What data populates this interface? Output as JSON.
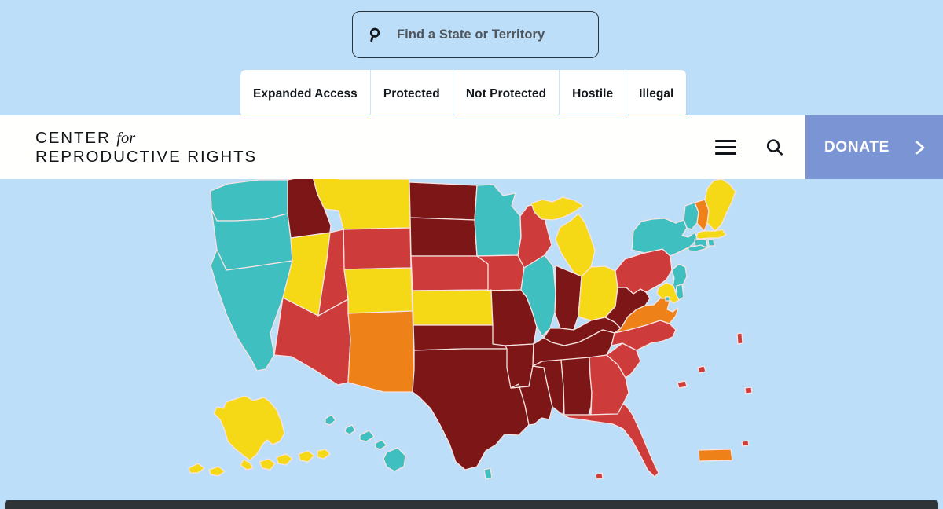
{
  "page": {
    "background_color": "#bcdef8",
    "bottom_bar_color": "#2f3438"
  },
  "search": {
    "icon": "search-icon",
    "placeholder": "Find a State or Territory",
    "value": ""
  },
  "legend": {
    "items": [
      {
        "label": "Expanded Access",
        "color": "#3fbfc0"
      },
      {
        "label": "Protected",
        "color": "#f5d916"
      },
      {
        "label": "Not Protected",
        "color": "#ef8119"
      },
      {
        "label": "Hostile",
        "color": "#cd3b3a"
      },
      {
        "label": "Illegal",
        "color": "#7d1717"
      }
    ]
  },
  "header": {
    "logo_line1": "CENTER",
    "logo_for": "for",
    "logo_line2": "REPRODUCTIVE RIGHTS",
    "menu_icon": "hamburger-menu-icon",
    "search_icon": "search-icon",
    "donate_label": "DONATE",
    "donate_chevron": "chevron-right-icon",
    "donate_color": "#7b94d4"
  },
  "map": {
    "type": "choropleth",
    "region": "United States and territories",
    "ocean_color": "#bcdef8",
    "border_color": "#f7e3e2",
    "categories": {
      "expanded_access": "#3fbfc0",
      "protected": "#f5d916",
      "not_protected": "#ef8119",
      "hostile": "#cd3b3a",
      "illegal": "#7d1717"
    },
    "states": [
      {
        "code": "WA",
        "name": "Washington",
        "status": "Expanded Access",
        "color": "#3fbfc0"
      },
      {
        "code": "OR",
        "name": "Oregon",
        "status": "Expanded Access",
        "color": "#3fbfc0"
      },
      {
        "code": "CA",
        "name": "California",
        "status": "Expanded Access",
        "color": "#3fbfc0"
      },
      {
        "code": "NV",
        "name": "Nevada",
        "status": "Protected",
        "color": "#f5d916"
      },
      {
        "code": "ID",
        "name": "Idaho",
        "status": "Illegal",
        "color": "#7d1717"
      },
      {
        "code": "MT",
        "name": "Montana",
        "status": "Protected",
        "color": "#f5d916"
      },
      {
        "code": "WY",
        "name": "Wyoming",
        "status": "Hostile",
        "color": "#cd3b3a"
      },
      {
        "code": "UT",
        "name": "Utah",
        "status": "Hostile",
        "color": "#cd3b3a"
      },
      {
        "code": "AZ",
        "name": "Arizona",
        "status": "Hostile",
        "color": "#cd3b3a"
      },
      {
        "code": "CO",
        "name": "Colorado",
        "status": "Protected",
        "color": "#f5d916"
      },
      {
        "code": "NM",
        "name": "New Mexico",
        "status": "Not Protected",
        "color": "#ef8119"
      },
      {
        "code": "ND",
        "name": "North Dakota",
        "status": "Illegal",
        "color": "#7d1717"
      },
      {
        "code": "SD",
        "name": "South Dakota",
        "status": "Illegal",
        "color": "#7d1717"
      },
      {
        "code": "NE",
        "name": "Nebraska",
        "status": "Hostile",
        "color": "#cd3b3a"
      },
      {
        "code": "KS",
        "name": "Kansas",
        "status": "Protected",
        "color": "#f5d916"
      },
      {
        "code": "OK",
        "name": "Oklahoma",
        "status": "Illegal",
        "color": "#7d1717"
      },
      {
        "code": "TX",
        "name": "Texas",
        "status": "Illegal",
        "color": "#7d1717"
      },
      {
        "code": "MN",
        "name": "Minnesota",
        "status": "Expanded Access",
        "color": "#3fbfc0"
      },
      {
        "code": "IA",
        "name": "Iowa",
        "status": "Hostile",
        "color": "#cd3b3a"
      },
      {
        "code": "MO",
        "name": "Missouri",
        "status": "Illegal",
        "color": "#7d1717"
      },
      {
        "code": "AR",
        "name": "Arkansas",
        "status": "Illegal",
        "color": "#7d1717"
      },
      {
        "code": "LA",
        "name": "Louisiana",
        "status": "Illegal",
        "color": "#7d1717"
      },
      {
        "code": "WI",
        "name": "Wisconsin",
        "status": "Hostile",
        "color": "#cd3b3a"
      },
      {
        "code": "IL",
        "name": "Illinois",
        "status": "Expanded Access",
        "color": "#3fbfc0"
      },
      {
        "code": "MI",
        "name": "Michigan",
        "status": "Protected",
        "color": "#f5d916"
      },
      {
        "code": "IN",
        "name": "Indiana",
        "status": "Illegal",
        "color": "#7d1717"
      },
      {
        "code": "OH",
        "name": "Ohio",
        "status": "Protected",
        "color": "#f5d916"
      },
      {
        "code": "KY",
        "name": "Kentucky",
        "status": "Illegal",
        "color": "#7d1717"
      },
      {
        "code": "TN",
        "name": "Tennessee",
        "status": "Illegal",
        "color": "#7d1717"
      },
      {
        "code": "MS",
        "name": "Mississippi",
        "status": "Illegal",
        "color": "#7d1717"
      },
      {
        "code": "AL",
        "name": "Alabama",
        "status": "Illegal",
        "color": "#7d1717"
      },
      {
        "code": "GA",
        "name": "Georgia",
        "status": "Hostile",
        "color": "#cd3b3a"
      },
      {
        "code": "FL",
        "name": "Florida",
        "status": "Hostile",
        "color": "#cd3b3a"
      },
      {
        "code": "SC",
        "name": "South Carolina",
        "status": "Hostile",
        "color": "#cd3b3a"
      },
      {
        "code": "NC",
        "name": "North Carolina",
        "status": "Hostile",
        "color": "#cd3b3a"
      },
      {
        "code": "VA",
        "name": "Virginia",
        "status": "Not Protected",
        "color": "#ef8119"
      },
      {
        "code": "WV",
        "name": "West Virginia",
        "status": "Illegal",
        "color": "#7d1717"
      },
      {
        "code": "PA",
        "name": "Pennsylvania",
        "status": "Hostile",
        "color": "#cd3b3a"
      },
      {
        "code": "NY",
        "name": "New York",
        "status": "Expanded Access",
        "color": "#3fbfc0"
      },
      {
        "code": "VT",
        "name": "Vermont",
        "status": "Expanded Access",
        "color": "#3fbfc0"
      },
      {
        "code": "NH",
        "name": "New Hampshire",
        "status": "Not Protected",
        "color": "#ef8119"
      },
      {
        "code": "ME",
        "name": "Maine",
        "status": "Protected",
        "color": "#f5d916"
      },
      {
        "code": "MA",
        "name": "Massachusetts",
        "status": "Protected",
        "color": "#f5d916"
      },
      {
        "code": "RI",
        "name": "Rhode Island",
        "status": "Expanded Access",
        "color": "#3fbfc0"
      },
      {
        "code": "CT",
        "name": "Connecticut",
        "status": "Expanded Access",
        "color": "#3fbfc0"
      },
      {
        "code": "NJ",
        "name": "New Jersey",
        "status": "Expanded Access",
        "color": "#3fbfc0"
      },
      {
        "code": "DE",
        "name": "Delaware",
        "status": "Expanded Access",
        "color": "#3fbfc0"
      },
      {
        "code": "MD",
        "name": "Maryland",
        "status": "Protected",
        "color": "#f5d916"
      },
      {
        "code": "DC",
        "name": "District of Columbia",
        "status": "Expanded Access",
        "color": "#3fbfc0"
      },
      {
        "code": "AK",
        "name": "Alaska",
        "status": "Protected",
        "color": "#f5d916"
      },
      {
        "code": "HI",
        "name": "Hawaii",
        "status": "Expanded Access",
        "color": "#3fbfc0"
      },
      {
        "code": "PR",
        "name": "Puerto Rico",
        "status": "Not Protected",
        "color": "#ef8119"
      },
      {
        "code": "VI",
        "name": "U.S. Virgin Islands",
        "status": "Hostile",
        "color": "#cd3b3a"
      }
    ]
  }
}
